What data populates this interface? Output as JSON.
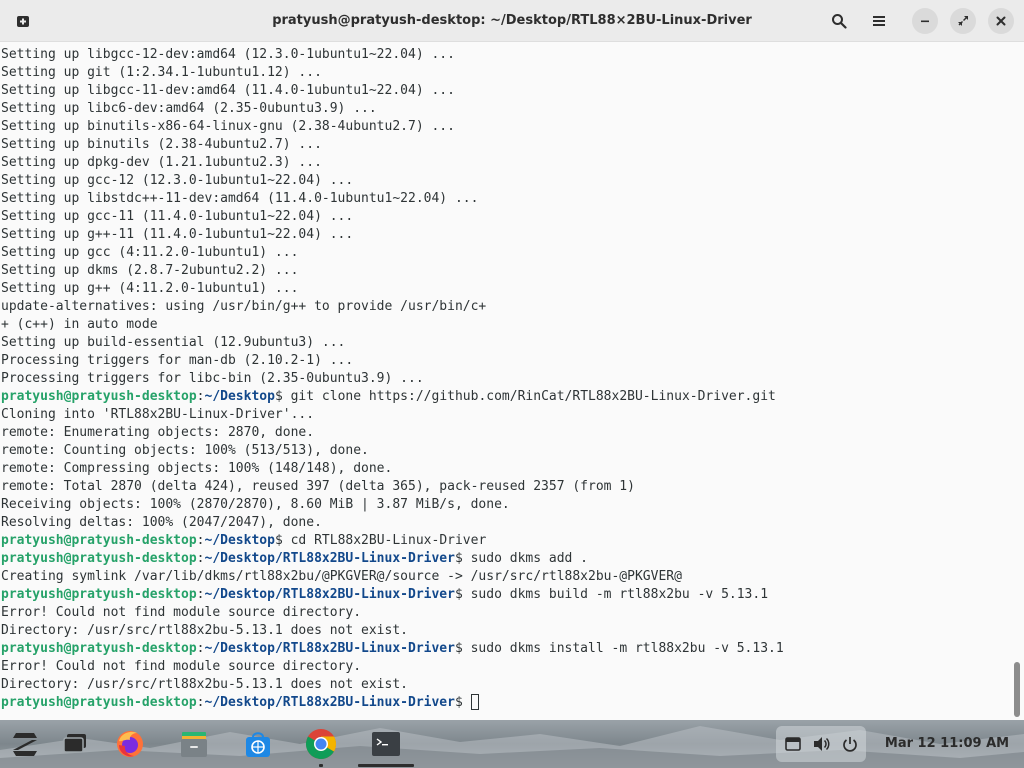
{
  "window": {
    "title": "pratyush@pratyush-desktop: ~/Desktop/RTL88×2BU-Linux-Driver"
  },
  "icons": {
    "new_tab": "new-tab-icon",
    "search": "search-icon",
    "menu": "hamburger-menu-icon",
    "minimize": "minimize-icon",
    "restore": "restore-icon",
    "close": "close-icon"
  },
  "terminal": {
    "lines": [
      {
        "text": "Setting up libgcc-12-dev:amd64 (12.3.0-1ubuntu1~22.04) ..."
      },
      {
        "text": "Setting up git (1:2.34.1-1ubuntu1.12) ..."
      },
      {
        "text": "Setting up libgcc-11-dev:amd64 (11.4.0-1ubuntu1~22.04) ..."
      },
      {
        "text": "Setting up libc6-dev:amd64 (2.35-0ubuntu3.9) ..."
      },
      {
        "text": "Setting up binutils-x86-64-linux-gnu (2.38-4ubuntu2.7) ..."
      },
      {
        "text": "Setting up binutils (2.38-4ubuntu2.7) ..."
      },
      {
        "text": "Setting up dpkg-dev (1.21.1ubuntu2.3) ..."
      },
      {
        "text": "Setting up gcc-12 (12.3.0-1ubuntu1~22.04) ..."
      },
      {
        "text": "Setting up libstdc++-11-dev:amd64 (11.4.0-1ubuntu1~22.04) ..."
      },
      {
        "text": "Setting up gcc-11 (11.4.0-1ubuntu1~22.04) ..."
      },
      {
        "text": "Setting up g++-11 (11.4.0-1ubuntu1~22.04) ..."
      },
      {
        "text": "Setting up gcc (4:11.2.0-1ubuntu1) ..."
      },
      {
        "text": "Setting up dkms (2.8.7-2ubuntu2.2) ..."
      },
      {
        "text": "Setting up g++ (4:11.2.0-1ubuntu1) ..."
      },
      {
        "text": "update-alternatives: using /usr/bin/g++ to provide /usr/bin/c+"
      },
      {
        "text": "+ (c++) in auto mode"
      },
      {
        "text": "Setting up build-essential (12.9ubuntu3) ..."
      },
      {
        "text": "Processing triggers for man-db (2.10.2-1) ..."
      },
      {
        "text": "Processing triggers for libc-bin (2.35-0ubuntu3.9) ..."
      },
      {
        "user": "pratyush@pratyush-desktop",
        "path": "~/Desktop",
        "cmd": "git clone https://github.com/RinCat/RTL88x2BU-Linux-Driver.git"
      },
      {
        "text": "Cloning into 'RTL88x2BU-Linux-Driver'..."
      },
      {
        "text": "remote: Enumerating objects: 2870, done."
      },
      {
        "text": "remote: Counting objects: 100% (513/513), done."
      },
      {
        "text": "remote: Compressing objects: 100% (148/148), done."
      },
      {
        "text": "remote: Total 2870 (delta 424), reused 397 (delta 365), pack-reused 2357 (from 1)"
      },
      {
        "text": "Receiving objects: 100% (2870/2870), 8.60 MiB | 3.87 MiB/s, done."
      },
      {
        "text": "Resolving deltas: 100% (2047/2047), done."
      },
      {
        "user": "pratyush@pratyush-desktop",
        "path": "~/Desktop",
        "cmd": "cd RTL88x2BU-Linux-Driver"
      },
      {
        "user": "pratyush@pratyush-desktop",
        "path": "~/Desktop/RTL88x2BU-Linux-Driver",
        "cmd": "sudo dkms add ."
      },
      {
        "text": "Creating symlink /var/lib/dkms/rtl88x2bu/@PKGVER@/source -> /usr/src/rtl88x2bu-@PKGVER@"
      },
      {
        "user": "pratyush@pratyush-desktop",
        "path": "~/Desktop/RTL88x2BU-Linux-Driver",
        "cmd": "sudo dkms build -m rtl88x2bu -v 5.13.1"
      },
      {
        "text": "Error! Could not find module source directory."
      },
      {
        "text": "Directory: /usr/src/rtl88x2bu-5.13.1 does not exist."
      },
      {
        "user": "pratyush@pratyush-desktop",
        "path": "~/Desktop/RTL88x2BU-Linux-Driver",
        "cmd": "sudo dkms install -m rtl88x2bu -v 5.13.1"
      },
      {
        "text": "Error! Could not find module source directory."
      },
      {
        "text": "Directory: /usr/src/rtl88x2bu-5.13.1 does not exist."
      },
      {
        "user": "pratyush@pratyush-desktop",
        "path": "~/Desktop/RTL88x2BU-Linux-Driver",
        "cmd": "",
        "cursor": true
      }
    ]
  },
  "taskbar": {
    "apps": [
      {
        "name": "zorin-menu-icon"
      },
      {
        "name": "workspaces-icon"
      },
      {
        "name": "firefox-icon"
      },
      {
        "name": "files-icon"
      },
      {
        "name": "software-store-icon"
      },
      {
        "name": "chrome-icon"
      },
      {
        "name": "terminal-icon"
      }
    ],
    "tray": {
      "icons": [
        "screen-icon",
        "volume-icon",
        "power-icon"
      ]
    },
    "clock": "Mar 12  11:09 AM"
  },
  "colors": {
    "prompt_user": "#26a269",
    "prompt_path": "#12488b",
    "terminal_bg": "#fafafa",
    "titlebar_bg": "#ebebeb"
  }
}
